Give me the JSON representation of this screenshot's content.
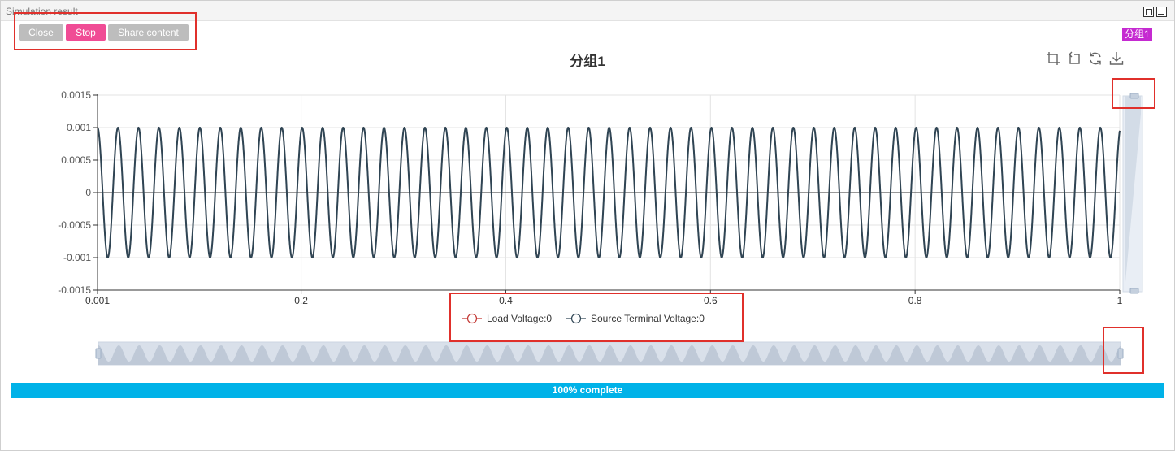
{
  "window": {
    "title": "Simulation result"
  },
  "toolbar": {
    "close_label": "Close",
    "stop_label": "Stop",
    "share_label": "Share content"
  },
  "group_tag": "分组1",
  "toolbox": {
    "icons": [
      "zoom-icon",
      "zoom-reset-icon",
      "restore-icon",
      "download-icon"
    ]
  },
  "progress": {
    "value": 100,
    "label": "100% complete"
  },
  "colors": {
    "stop": "#f04c95",
    "secondary": "#bdbdbd",
    "group_tag": "#c52ad1",
    "progress": "#00b2e8",
    "load_voltage": "#c23531",
    "source_voltage": "#2f4554",
    "highlight": "#e0302b"
  },
  "chart_data": {
    "type": "line",
    "title": "分组1",
    "x_ticks": [
      "0.001",
      "0.2",
      "0.4",
      "0.6",
      "0.8",
      "1"
    ],
    "y_ticks": [
      "0.0015",
      "0.001",
      "0.0005",
      "0",
      "-0.0005",
      "-0.001",
      "-0.0015"
    ],
    "xlim": [
      0.001,
      1
    ],
    "ylim": [
      -0.0015,
      0.0015
    ],
    "grid": true,
    "legend_position": "bottom",
    "series": [
      {
        "name": "Load Voltage:0",
        "waveform": "sine",
        "amplitude": 0.001,
        "frequency": 50,
        "values": []
      },
      {
        "name": "Source Terminal Voltage:0",
        "waveform": "sine",
        "amplitude": 0.001,
        "frequency": 50,
        "values": []
      }
    ],
    "data_zoom": {
      "x_range": [
        0,
        100
      ],
      "y_range": [
        0,
        100
      ]
    }
  }
}
